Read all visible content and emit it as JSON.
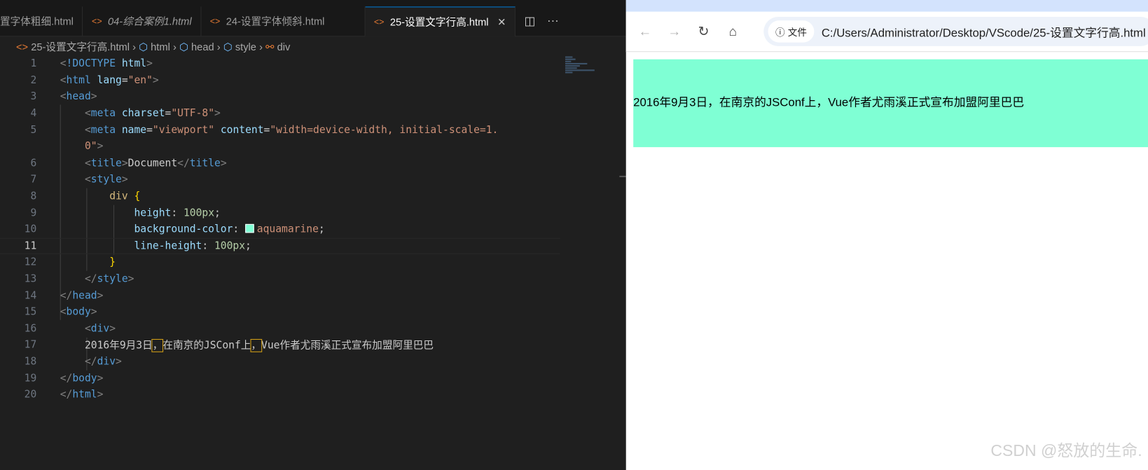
{
  "editor": {
    "tabs": [
      {
        "label": "置字体粗细.html"
      },
      {
        "label": "04-综合案例1.html"
      },
      {
        "label": "24-设置字体倾斜.html"
      },
      {
        "label": "25-设置文字行高.html",
        "active": true
      }
    ],
    "breadcrumb": [
      "25-设置文字行高.html",
      "html",
      "head",
      "style",
      "div"
    ],
    "lines": [
      "1",
      "2",
      "3",
      "4",
      "5",
      "",
      "6",
      "7",
      "8",
      "9",
      "10",
      "11",
      "12",
      "13",
      "14",
      "15",
      "16",
      "17",
      "18",
      "19",
      "20"
    ],
    "current_line": "11",
    "swatch_color": "#7fffd4"
  },
  "browser": {
    "chip_label": "文件",
    "url": "C:/Users/Administrator/Desktop/VScode/25-设置文字行高.html",
    "content": "2016年9月3日，在南京的JSConf上，Vue作者尤雨溪正式宣布加盟阿里巴巴",
    "div_color": "#7fffd4"
  },
  "watermark": "CSDN @怒放的生命."
}
